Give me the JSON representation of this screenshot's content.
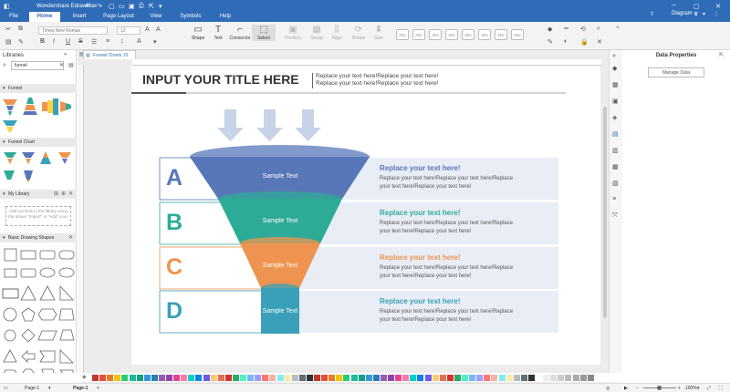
{
  "app": {
    "title": "Wondershare EdrawMax"
  },
  "menu": {
    "tabs": [
      "File",
      "Home",
      "Insert",
      "Page Layout",
      "View",
      "Symbols",
      "Help"
    ],
    "active": "Home"
  },
  "topright": {
    "diagram_label": "Diagram"
  },
  "ribbon": {
    "font_name": "Times New Roman",
    "font_size": "12",
    "tools": [
      {
        "label": "Shape",
        "enabled": true
      },
      {
        "label": "Text",
        "enabled": true
      },
      {
        "label": "Connector",
        "enabled": true
      },
      {
        "label": "Select",
        "enabled": true
      },
      {
        "label": "Position",
        "enabled": false
      },
      {
        "label": "Group",
        "enabled": false
      },
      {
        "label": "Align",
        "enabled": false
      },
      {
        "label": "Rotate",
        "enabled": false
      },
      {
        "label": "Size",
        "enabled": false
      }
    ],
    "style_swatch_label": "Abc"
  },
  "sidebar": {
    "title": "Libraries",
    "search_value": "funnel",
    "sections": [
      "Funnel",
      "Funnel Chart",
      "My Library",
      "Basic Drawing Shapes"
    ],
    "my_library_note": "Add symbols to the library using the above \"Import\" or \"Add\" icon."
  },
  "document": {
    "tab_name": "Funnel Charts 10"
  },
  "diagram": {
    "title": "INPUT YOUR TITLE HERE",
    "subtitle_line1": "Replace your text here!Replace your text here!",
    "subtitle_line2": "Replace your text here!Replace your text here!",
    "rows": [
      {
        "letter": "A",
        "funnel_text": "Sample Text",
        "heading": "Replace your text here!",
        "body1": "Replace your text here!Replace your text here!Replace",
        "body2": "your text here!Replace your text here!",
        "color": "#5877b9"
      },
      {
        "letter": "B",
        "funnel_text": "Sample Text",
        "heading": "Replace your text here!",
        "body1": "Replace your text here!Replace your text here!Replace",
        "body2": "your text here!Replace your text here!",
        "color": "#2eab97"
      },
      {
        "letter": "C",
        "funnel_text": "Sample Text",
        "heading": "Replace your text here!",
        "body1": "Replace your text here!Replace your text here!Replace",
        "body2": "your text here!Replace your text here!",
        "color": "#ef9450"
      },
      {
        "letter": "D",
        "funnel_text": "Sample Text",
        "heading": "Replace your text here!",
        "body1": "Replace your text here!Replace your text here!Replace",
        "body2": "your text here!Replace your text here!",
        "color": "#3aa0b9"
      }
    ]
  },
  "panel": {
    "title": "Data Properties",
    "manage_button": "Manage Data"
  },
  "status": {
    "page_select": "Page-1",
    "page_tab": "Page-1",
    "zoom": "100%"
  },
  "colors": {
    "brand": "#2f6cb7",
    "arrow": "#c7d3e6",
    "row_bg": "#e8edf6"
  }
}
